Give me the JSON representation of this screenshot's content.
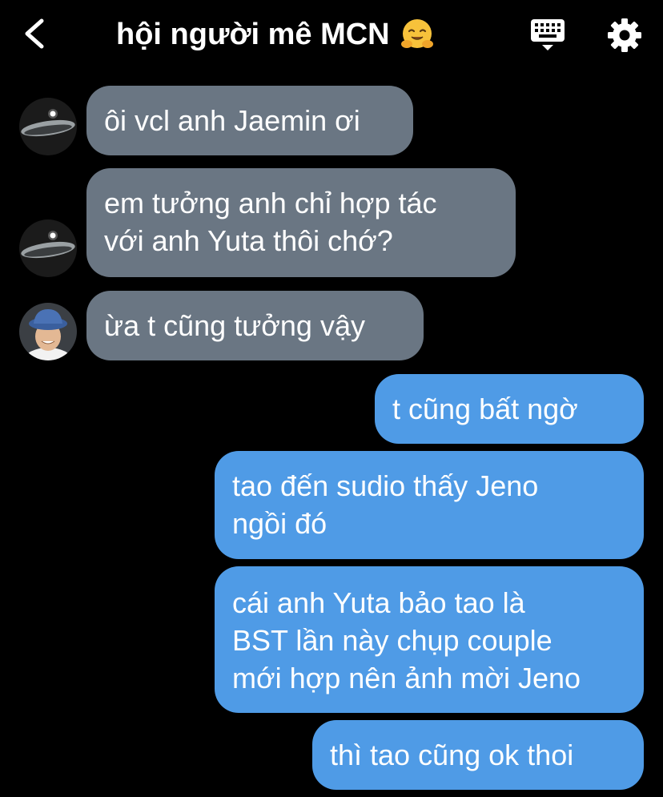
{
  "header": {
    "title": "hội người mê MCN",
    "title_emoji": "hugging-face-emoji",
    "back_icon": "chevron-left-icon",
    "keyboard_icon": "keyboard-icon",
    "settings_icon": "gear-icon"
  },
  "colors": {
    "background": "#000000",
    "incoming_bubble": "#6a7683",
    "outgoing_bubble": "#4f9be6",
    "text": "#ffffff"
  },
  "messages": [
    {
      "direction": "incoming",
      "avatar": "planet-avatar",
      "lines": [
        "ôi vcl anh Jaemin ơi"
      ]
    },
    {
      "direction": "incoming",
      "avatar": "planet-avatar",
      "lines": [
        "em tưởng anh chỉ hợp tác",
        "với anh Yuta thôi chớ?"
      ]
    },
    {
      "direction": "incoming",
      "avatar": "person-bucket-hat-avatar",
      "lines": [
        "ừa t cũng tưởng vậy"
      ]
    },
    {
      "direction": "outgoing",
      "lines": [
        "t cũng bất ngờ"
      ]
    },
    {
      "direction": "outgoing",
      "lines": [
        "tao đến sudio thấy Jeno",
        "ngồi đó"
      ]
    },
    {
      "direction": "outgoing",
      "lines": [
        "cái anh Yuta bảo tao là",
        "BST lần này chụp couple",
        "mới hợp nên ảnh mời Jeno"
      ]
    },
    {
      "direction": "outgoing",
      "lines": [
        "thì tao cũng ok thoi"
      ]
    }
  ]
}
